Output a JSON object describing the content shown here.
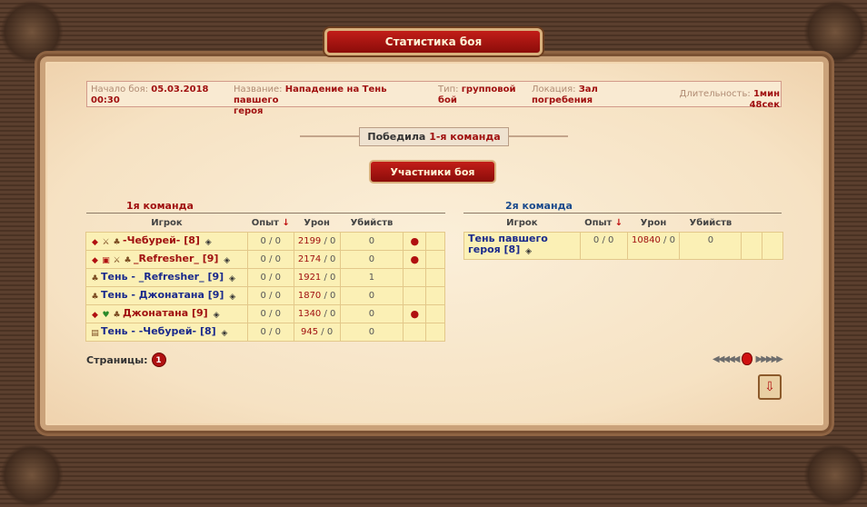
{
  "window": {
    "title": "Статистика боя"
  },
  "battle_info": {
    "start_label": "Начало боя:",
    "start_value_line1": "05.03.2018",
    "start_value_line2": "00:30",
    "name_label": "Название:",
    "name_value_line1": "Нападение на Тень павшего",
    "name_value_line2": "героя",
    "type_label": "Тип:",
    "type_value_line1": "групповой",
    "type_value_line2": "бой",
    "location_label": "Локация:",
    "location_value_line1": "Зал",
    "location_value_line2": "погребения",
    "duration_label": "Длительность:",
    "duration_value": "1мин 48сек"
  },
  "result": {
    "prefix": "Победила",
    "winner": "1-я команда"
  },
  "participants_label": "Участники боя",
  "columns": {
    "player": "Игрок",
    "exp": "Опыт",
    "damage": "Урон",
    "kills": "Убийств"
  },
  "team1": {
    "title": "1я команда",
    "rows": [
      {
        "name": "-Чебурей- [8]",
        "exp": "0 / 0",
        "dmg": "2199",
        "dmg_total": "0",
        "kills": "0",
        "bomb": true,
        "color": "red"
      },
      {
        "name": "_Refresher_ [9]",
        "exp": "0 / 0",
        "dmg": "2174",
        "dmg_total": "0",
        "kills": "0",
        "bomb": true,
        "color": "red"
      },
      {
        "name": "Тень - _Refresher_ [9]",
        "exp": "0 / 0",
        "dmg": "1921",
        "dmg_total": "0",
        "kills": "1",
        "bomb": false,
        "color": "blue"
      },
      {
        "name": "Тень - Джонатана [9]",
        "exp": "0 / 0",
        "dmg": "1870",
        "dmg_total": "0",
        "kills": "0",
        "bomb": false,
        "color": "blue"
      },
      {
        "name": "Джонатана [9]",
        "exp": "0 / 0",
        "dmg": "1340",
        "dmg_total": "0",
        "kills": "0",
        "bomb": true,
        "color": "red"
      },
      {
        "name": "Тень - -Чебурей- [8]",
        "exp": "0 / 0",
        "dmg": "945",
        "dmg_total": "0",
        "kills": "0",
        "bomb": false,
        "color": "blue"
      }
    ]
  },
  "team2": {
    "title": "2я команда",
    "rows": [
      {
        "name_line1": "Тень павшего",
        "name_line2": "героя [8]",
        "exp": "0 / 0",
        "dmg": "10840",
        "dmg_total": "0",
        "kills": "0"
      }
    ]
  },
  "pagination": {
    "label": "Страницы:",
    "current": "1"
  },
  "icons": [
    "sort-down-icon",
    "bomb-icon",
    "diamond-icon",
    "scroll-icon"
  ],
  "colors": {
    "accent_red": "#a01010",
    "name_blue": "#1a2a8c",
    "row_bg": "#fbf0b5"
  }
}
